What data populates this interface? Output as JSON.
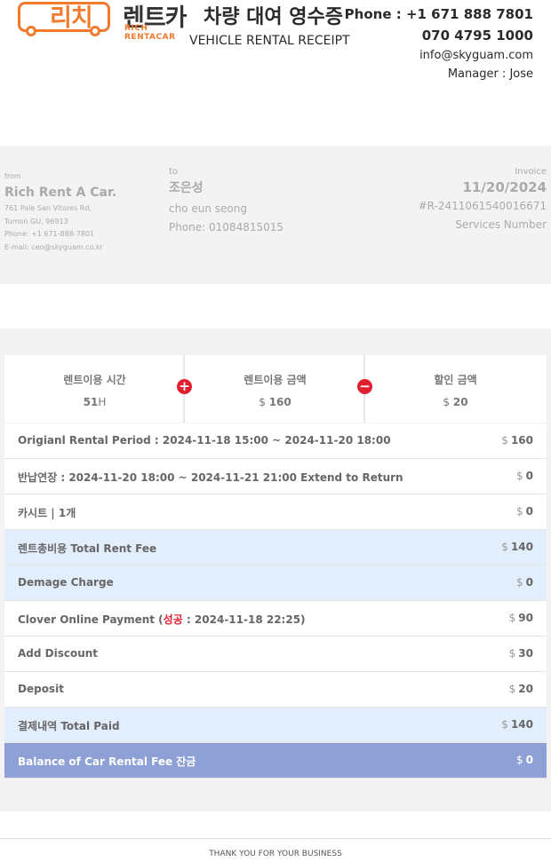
{
  "header": {
    "logo_kr_1": "리치",
    "logo_kr_2": "렌트카",
    "logo_en": "RICH RENTACAR",
    "title_kr": "차량 대여 영수증",
    "title_en": "VEHICLE RENTAL RECEIPT",
    "phone_1": "Phone : +1 671 888 7801",
    "phone_2": "070 4795 1000",
    "email": "info@skyguam.com",
    "manager": "Manager : Jose"
  },
  "from": {
    "label": "from",
    "company": "Rich Rent A Car.",
    "address_1": "761 Pale San Vitores Rd,",
    "address_2": "Tumon GU, 96913",
    "phone": "Phone: +1 671-888-7801",
    "email": "E-mail: ceo@skyguam.co.kr"
  },
  "to": {
    "label": "to",
    "name_kr": "조은성",
    "name_en": "cho eun seong",
    "phone": "Phone: 01084815015"
  },
  "invoice": {
    "label": "Invoice",
    "date": "11/20/2024",
    "number": "#R-2411061540016671",
    "services": "Services Number"
  },
  "summary": {
    "time_label": "렌트이용 시간",
    "time_value": "51",
    "time_unit": "H",
    "amount_label": "렌트이용 금액",
    "amount_currency": "$",
    "amount_value": "160",
    "discount_label": "할인 금액",
    "discount_currency": "$",
    "discount_value": "20",
    "plus_icon": "+",
    "minus_icon": "−"
  },
  "rows": [
    {
      "label": "Origianl Rental Period : 2024-11-18 15:00 ~ 2024-11-20 18:00",
      "currency": "$",
      "value": "160"
    },
    {
      "label": "반납연장 : 2024-11-20 18:00 ~ 2024-11-21 21:00 Extend to Return",
      "currency": "$",
      "value": "0"
    },
    {
      "label": "카시트 | 1개",
      "currency": "$",
      "value": "0"
    },
    {
      "label": "렌트총비용 Total Rent Fee",
      "currency": "$",
      "value": "140"
    },
    {
      "label": "Demage Charge",
      "currency": "$",
      "value": "0"
    },
    {
      "label_pre": "Clover Online Payment (",
      "label_ok": "성공",
      "label_post": " : 2024-11-18 22:25)",
      "currency": "$",
      "value": "90"
    },
    {
      "label": "Add Discount",
      "currency": "$",
      "value": "30"
    },
    {
      "label": "Deposit",
      "currency": "$",
      "value": "20"
    },
    {
      "label": "결제내역 Total Paid",
      "currency": "$",
      "value": "140"
    },
    {
      "label": "Balance of Car Rental Fee 잔금",
      "currency": "$",
      "value": "0"
    }
  ],
  "footer": "THANK YOU FOR YOUR BUSINESS",
  "colors": {
    "brand_orange": "#f07a2e",
    "accent_red": "#e02030",
    "highlight_blue": "#e3eefc",
    "balance_blue": "#8ea0d6"
  }
}
